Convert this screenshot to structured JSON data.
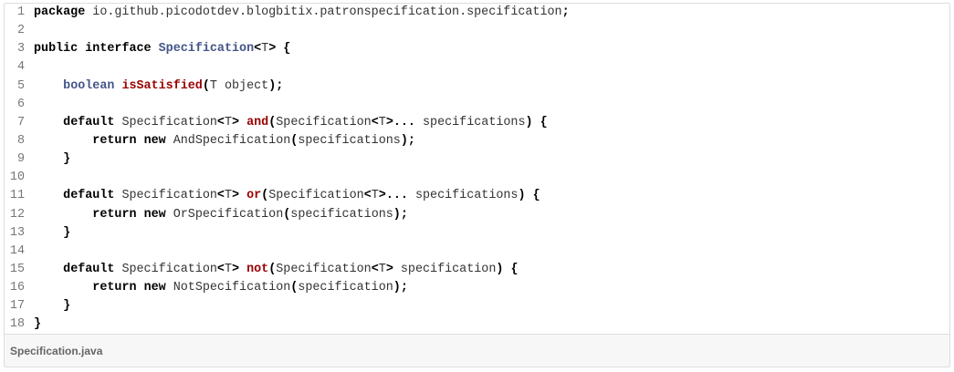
{
  "file": {
    "name": "Specification.java"
  },
  "lines": [
    {
      "n": "1",
      "tokens": [
        {
          "c": "kw",
          "t": "package"
        },
        {
          "c": "tx",
          "t": " io.github.picodotdev.blogbitix.patronspecification.specification"
        },
        {
          "c": "pu",
          "t": ";"
        }
      ]
    },
    {
      "n": "2",
      "tokens": []
    },
    {
      "n": "3",
      "tokens": [
        {
          "c": "kw",
          "t": "public"
        },
        {
          "c": "tx",
          "t": " "
        },
        {
          "c": "kw",
          "t": "interface"
        },
        {
          "c": "tx",
          "t": " "
        },
        {
          "c": "ty",
          "t": "Specification"
        },
        {
          "c": "pu",
          "t": "<"
        },
        {
          "c": "tx",
          "t": "T"
        },
        {
          "c": "pu",
          "t": ">"
        },
        {
          "c": "tx",
          "t": " "
        },
        {
          "c": "pu",
          "t": "{"
        }
      ]
    },
    {
      "n": "4",
      "tokens": []
    },
    {
      "n": "5",
      "tokens": [
        {
          "c": "tx",
          "t": "    "
        },
        {
          "c": "ty",
          "t": "boolean"
        },
        {
          "c": "tx",
          "t": " "
        },
        {
          "c": "fn",
          "t": "isSatisfied"
        },
        {
          "c": "pu",
          "t": "("
        },
        {
          "c": "tx",
          "t": "T object"
        },
        {
          "c": "pu",
          "t": ");"
        }
      ]
    },
    {
      "n": "6",
      "tokens": []
    },
    {
      "n": "7",
      "tokens": [
        {
          "c": "tx",
          "t": "    "
        },
        {
          "c": "kw",
          "t": "default"
        },
        {
          "c": "tx",
          "t": " Specification"
        },
        {
          "c": "pu",
          "t": "<"
        },
        {
          "c": "tx",
          "t": "T"
        },
        {
          "c": "pu",
          "t": ">"
        },
        {
          "c": "tx",
          "t": " "
        },
        {
          "c": "fn",
          "t": "and"
        },
        {
          "c": "pu",
          "t": "("
        },
        {
          "c": "tx",
          "t": "Specification"
        },
        {
          "c": "pu",
          "t": "<"
        },
        {
          "c": "tx",
          "t": "T"
        },
        {
          "c": "pu",
          "t": ">..."
        },
        {
          "c": "tx",
          "t": " specifications"
        },
        {
          "c": "pu",
          "t": ")"
        },
        {
          "c": "tx",
          "t": " "
        },
        {
          "c": "pu",
          "t": "{"
        }
      ]
    },
    {
      "n": "8",
      "tokens": [
        {
          "c": "tx",
          "t": "        "
        },
        {
          "c": "kw",
          "t": "return"
        },
        {
          "c": "tx",
          "t": " "
        },
        {
          "c": "kw",
          "t": "new"
        },
        {
          "c": "tx",
          "t": " AndSpecification"
        },
        {
          "c": "pu",
          "t": "("
        },
        {
          "c": "tx",
          "t": "specifications"
        },
        {
          "c": "pu",
          "t": ");"
        }
      ]
    },
    {
      "n": "9",
      "tokens": [
        {
          "c": "tx",
          "t": "    "
        },
        {
          "c": "pu",
          "t": "}"
        }
      ]
    },
    {
      "n": "10",
      "tokens": []
    },
    {
      "n": "11",
      "tokens": [
        {
          "c": "tx",
          "t": "    "
        },
        {
          "c": "kw",
          "t": "default"
        },
        {
          "c": "tx",
          "t": " Specification"
        },
        {
          "c": "pu",
          "t": "<"
        },
        {
          "c": "tx",
          "t": "T"
        },
        {
          "c": "pu",
          "t": ">"
        },
        {
          "c": "tx",
          "t": " "
        },
        {
          "c": "fn",
          "t": "or"
        },
        {
          "c": "pu",
          "t": "("
        },
        {
          "c": "tx",
          "t": "Specification"
        },
        {
          "c": "pu",
          "t": "<"
        },
        {
          "c": "tx",
          "t": "T"
        },
        {
          "c": "pu",
          "t": ">..."
        },
        {
          "c": "tx",
          "t": " specifications"
        },
        {
          "c": "pu",
          "t": ")"
        },
        {
          "c": "tx",
          "t": " "
        },
        {
          "c": "pu",
          "t": "{"
        }
      ]
    },
    {
      "n": "12",
      "tokens": [
        {
          "c": "tx",
          "t": "        "
        },
        {
          "c": "kw",
          "t": "return"
        },
        {
          "c": "tx",
          "t": " "
        },
        {
          "c": "kw",
          "t": "new"
        },
        {
          "c": "tx",
          "t": " OrSpecification"
        },
        {
          "c": "pu",
          "t": "("
        },
        {
          "c": "tx",
          "t": "specifications"
        },
        {
          "c": "pu",
          "t": ");"
        }
      ]
    },
    {
      "n": "13",
      "tokens": [
        {
          "c": "tx",
          "t": "    "
        },
        {
          "c": "pu",
          "t": "}"
        }
      ]
    },
    {
      "n": "14",
      "tokens": []
    },
    {
      "n": "15",
      "tokens": [
        {
          "c": "tx",
          "t": "    "
        },
        {
          "c": "kw",
          "t": "default"
        },
        {
          "c": "tx",
          "t": " Specification"
        },
        {
          "c": "pu",
          "t": "<"
        },
        {
          "c": "tx",
          "t": "T"
        },
        {
          "c": "pu",
          "t": ">"
        },
        {
          "c": "tx",
          "t": " "
        },
        {
          "c": "fn",
          "t": "not"
        },
        {
          "c": "pu",
          "t": "("
        },
        {
          "c": "tx",
          "t": "Specification"
        },
        {
          "c": "pu",
          "t": "<"
        },
        {
          "c": "tx",
          "t": "T"
        },
        {
          "c": "pu",
          "t": ">"
        },
        {
          "c": "tx",
          "t": " specification"
        },
        {
          "c": "pu",
          "t": ")"
        },
        {
          "c": "tx",
          "t": " "
        },
        {
          "c": "pu",
          "t": "{"
        }
      ]
    },
    {
      "n": "16",
      "tokens": [
        {
          "c": "tx",
          "t": "        "
        },
        {
          "c": "kw",
          "t": "return"
        },
        {
          "c": "tx",
          "t": " "
        },
        {
          "c": "kw",
          "t": "new"
        },
        {
          "c": "tx",
          "t": " NotSpecification"
        },
        {
          "c": "pu",
          "t": "("
        },
        {
          "c": "tx",
          "t": "specification"
        },
        {
          "c": "pu",
          "t": ");"
        }
      ]
    },
    {
      "n": "17",
      "tokens": [
        {
          "c": "tx",
          "t": "    "
        },
        {
          "c": "pu",
          "t": "}"
        }
      ]
    },
    {
      "n": "18",
      "tokens": [
        {
          "c": "pu",
          "t": "}"
        }
      ]
    }
  ],
  "colors": {
    "keyword": "#000000",
    "type": "#445588",
    "function": "#990000",
    "text": "#333333",
    "line_number": "#777777",
    "footer_background": "#f7f7f7",
    "border": "#dddddd"
  }
}
